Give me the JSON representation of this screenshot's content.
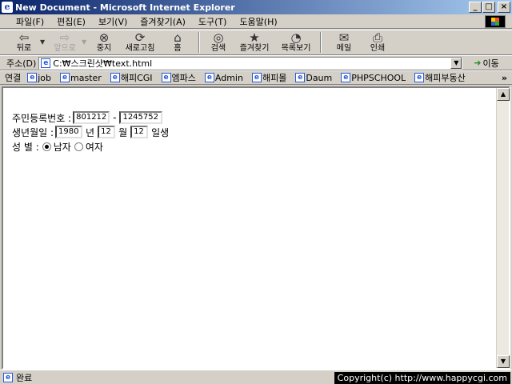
{
  "window": {
    "title": "New Document - Microsoft Internet Explorer",
    "app_icon": "ie-page-icon",
    "controls": [
      "_",
      "□",
      "×"
    ]
  },
  "menu": [
    "파일(F)",
    "편집(E)",
    "보기(V)",
    "즐겨찾기(A)",
    "도구(T)",
    "도움말(H)"
  ],
  "toolbar": {
    "back": {
      "label": "뒤로",
      "icon": "back-arrow-icon"
    },
    "forward": {
      "label": "앞으로",
      "icon": "forward-arrow-icon"
    },
    "stop": {
      "label": "중지",
      "icon": "stop-icon"
    },
    "refresh": {
      "label": "새로고침",
      "icon": "refresh-icon"
    },
    "home": {
      "label": "홈",
      "icon": "home-icon"
    },
    "search": {
      "label": "검색",
      "icon": "search-icon"
    },
    "favorites": {
      "label": "즐겨찾기",
      "icon": "favorites-icon"
    },
    "history": {
      "label": "목록보기",
      "icon": "history-icon"
    },
    "mail": {
      "label": "메일",
      "icon": "mail-icon"
    },
    "print": {
      "label": "인쇄",
      "icon": "print-icon"
    }
  },
  "address": {
    "label": "주소(D)",
    "value": "C:₩스크린샷₩text.html",
    "go_label": "이동"
  },
  "links": {
    "label": "연결",
    "items": [
      "job",
      "master",
      "해피CGI",
      "엠파스",
      "Admin",
      "해피몰",
      "Daum",
      "PHPSCHOOL",
      "해피부동산"
    ],
    "more": "»"
  },
  "form": {
    "ssn_label": "주민등록번호 :",
    "ssn_front": "801212",
    "ssn_dash": "-",
    "ssn_back": "1245752",
    "birth_label": "생년월일 :",
    "birth_year": "1980",
    "year_unit": "년",
    "birth_month": "12",
    "month_unit": "월",
    "birth_day": "12",
    "day_unit": "일생",
    "gender_label": "성 별 :",
    "gender_male": "남자",
    "gender_female": "여자",
    "gender_selected": "남자"
  },
  "status": {
    "text": "완료",
    "copyright": "Copyright(c) http://www.happycgi.com"
  }
}
